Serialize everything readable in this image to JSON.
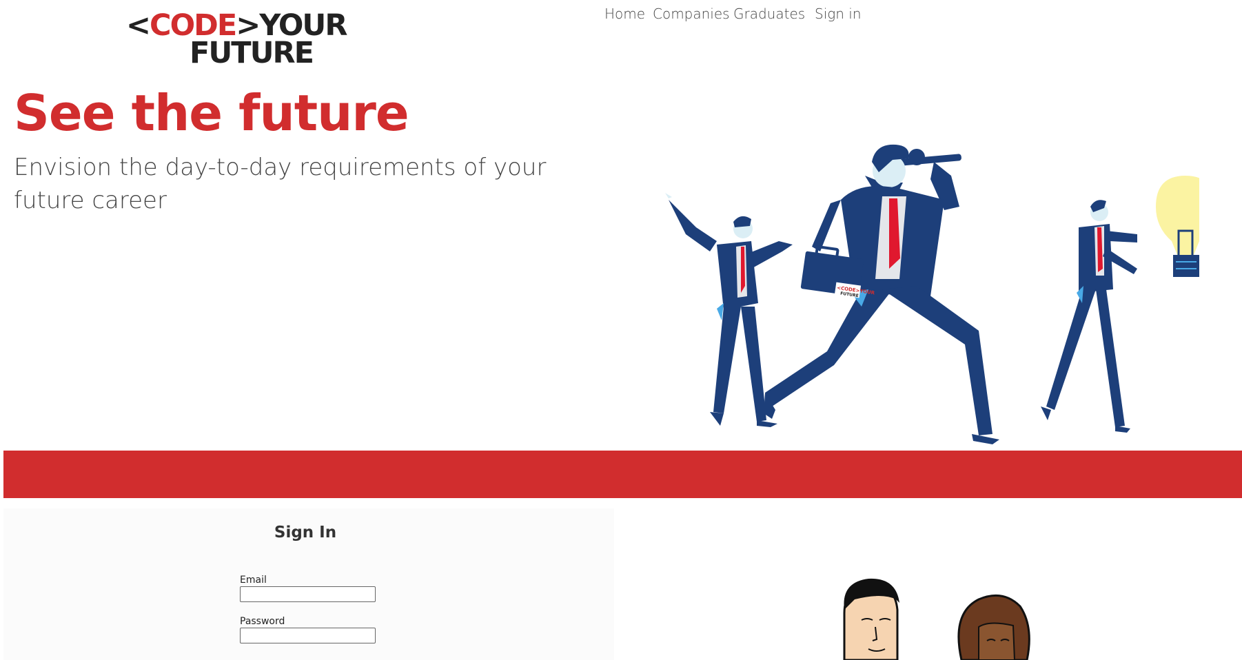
{
  "logo": {
    "open": "<",
    "code": "CODE",
    "close": ">",
    "your": "YOUR",
    "future": "FUTURE",
    "briefcase_code": "<CODE>YOUR",
    "briefcase_future": "FUTURE"
  },
  "nav": {
    "items": [
      {
        "label": "Home"
      },
      {
        "label": "Companies"
      },
      {
        "label": "Graduates"
      },
      {
        "label": "Sign in"
      }
    ]
  },
  "hero": {
    "title": "See the future",
    "subtitle": "Envision the day-to-day requirements of your future career"
  },
  "signin": {
    "title": "Sign In",
    "email_label": "Email",
    "email_value": "",
    "password_label": "Password",
    "password_value": ""
  },
  "colors": {
    "brand_red": "#d12d2e",
    "suit_navy": "#1d3f7a",
    "bulb_yellow": "#fbf3a2"
  }
}
